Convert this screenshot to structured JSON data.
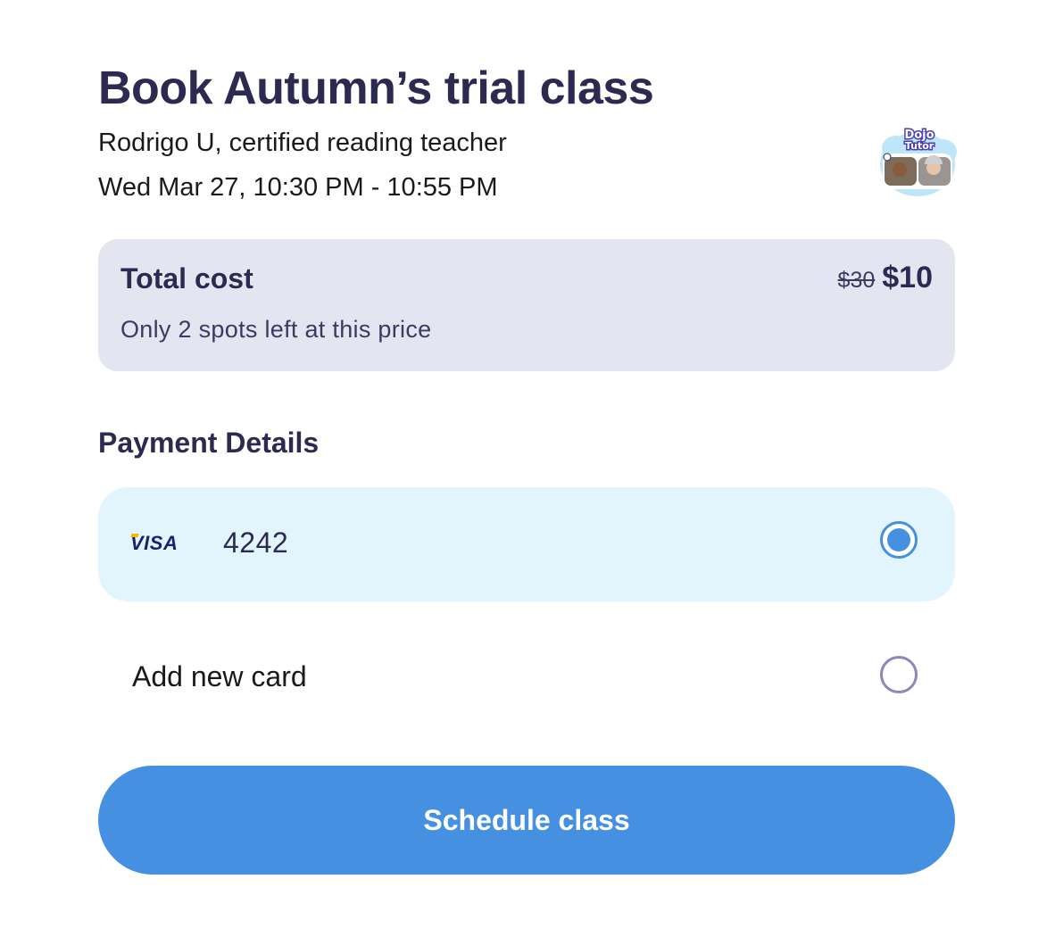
{
  "header": {
    "title": "Book Autumn’s trial class",
    "teacher": "Rodrigo U, certified reading teacher",
    "time": "Wed Mar 27, 10:30 PM - 10:55 PM",
    "logo_text_top": "Dojo",
    "logo_text_bottom": "Tutor"
  },
  "cost": {
    "title": "Total cost",
    "note": "Only 2 spots left at this price",
    "old_price": "$30",
    "new_price": "$10"
  },
  "payment": {
    "heading": "Payment Details",
    "saved_card": {
      "brand": "VISA",
      "last4": "4242",
      "selected": true
    },
    "add_card": {
      "label": "Add new card",
      "selected": false
    }
  },
  "actions": {
    "schedule_label": "Schedule class"
  },
  "colors": {
    "primary": "#4590e0",
    "heading": "#2c2a50",
    "cost_panel_bg": "#e3e5f0",
    "selected_card_bg": "#e2f5fc",
    "radio_unselected": "#8c88b8",
    "visa_blue": "#1a1f71"
  }
}
